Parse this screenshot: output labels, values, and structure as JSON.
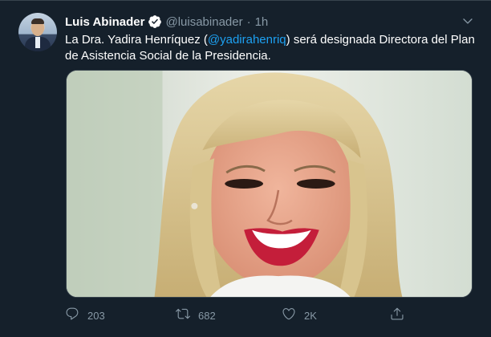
{
  "tweet": {
    "author_name": "Luis Abinader",
    "handle": "@luisabinader",
    "separator": "·",
    "time": "1h",
    "text_before": "La Dra. Yadira Henríquez (",
    "mention": "@yadirahenriq",
    "text_after": ") será designada Directora del Plan de Asistencia Social de la Presidencia.",
    "image_alt": "Portrait of a smiling woman with blonde hair"
  },
  "actions": {
    "reply_count": "203",
    "retweet_count": "682",
    "like_count": "2K"
  },
  "icons": {
    "verified": "verified-badge-icon",
    "caret": "chevron-down-icon",
    "reply": "reply-icon",
    "retweet": "retweet-icon",
    "like": "heart-icon",
    "share": "share-icon"
  },
  "colors": {
    "background": "#15202b",
    "text": "#ffffff",
    "secondary": "#8899a6",
    "accent": "#1da1f2",
    "border": "#38444d"
  }
}
